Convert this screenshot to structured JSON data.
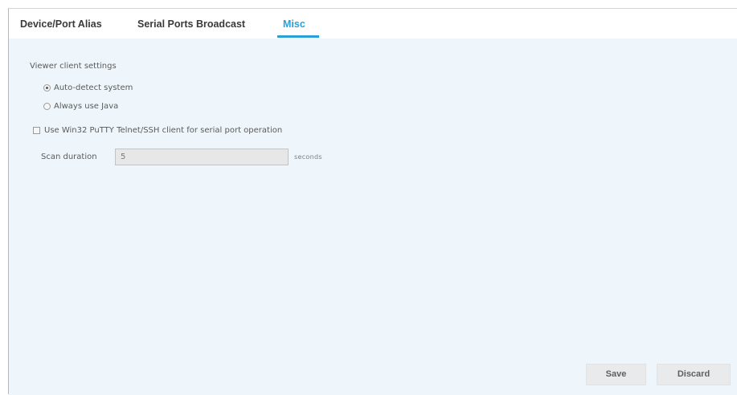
{
  "tabs": [
    {
      "label": "Device/Port Alias"
    },
    {
      "label": "Serial Ports Broadcast"
    },
    {
      "label": "Misc",
      "active": true
    }
  ],
  "misc": {
    "viewer_section_label": "Viewer client settings",
    "radio_options": [
      {
        "label": "Auto-detect system",
        "checked": true
      },
      {
        "label": "Always use Java",
        "checked": false
      }
    ],
    "putty_checkbox": {
      "label": "Use Win32 PuTTY Telnet/SSH client for serial port operation",
      "checked": false
    },
    "scan_duration": {
      "label": "Scan duration",
      "value": "5",
      "unit": "seconds"
    }
  },
  "buttons": {
    "save_label": "Save",
    "discard_label": "Discard"
  },
  "colors": {
    "accent": "#2aa0d8",
    "content_background": "#eef6fb"
  }
}
